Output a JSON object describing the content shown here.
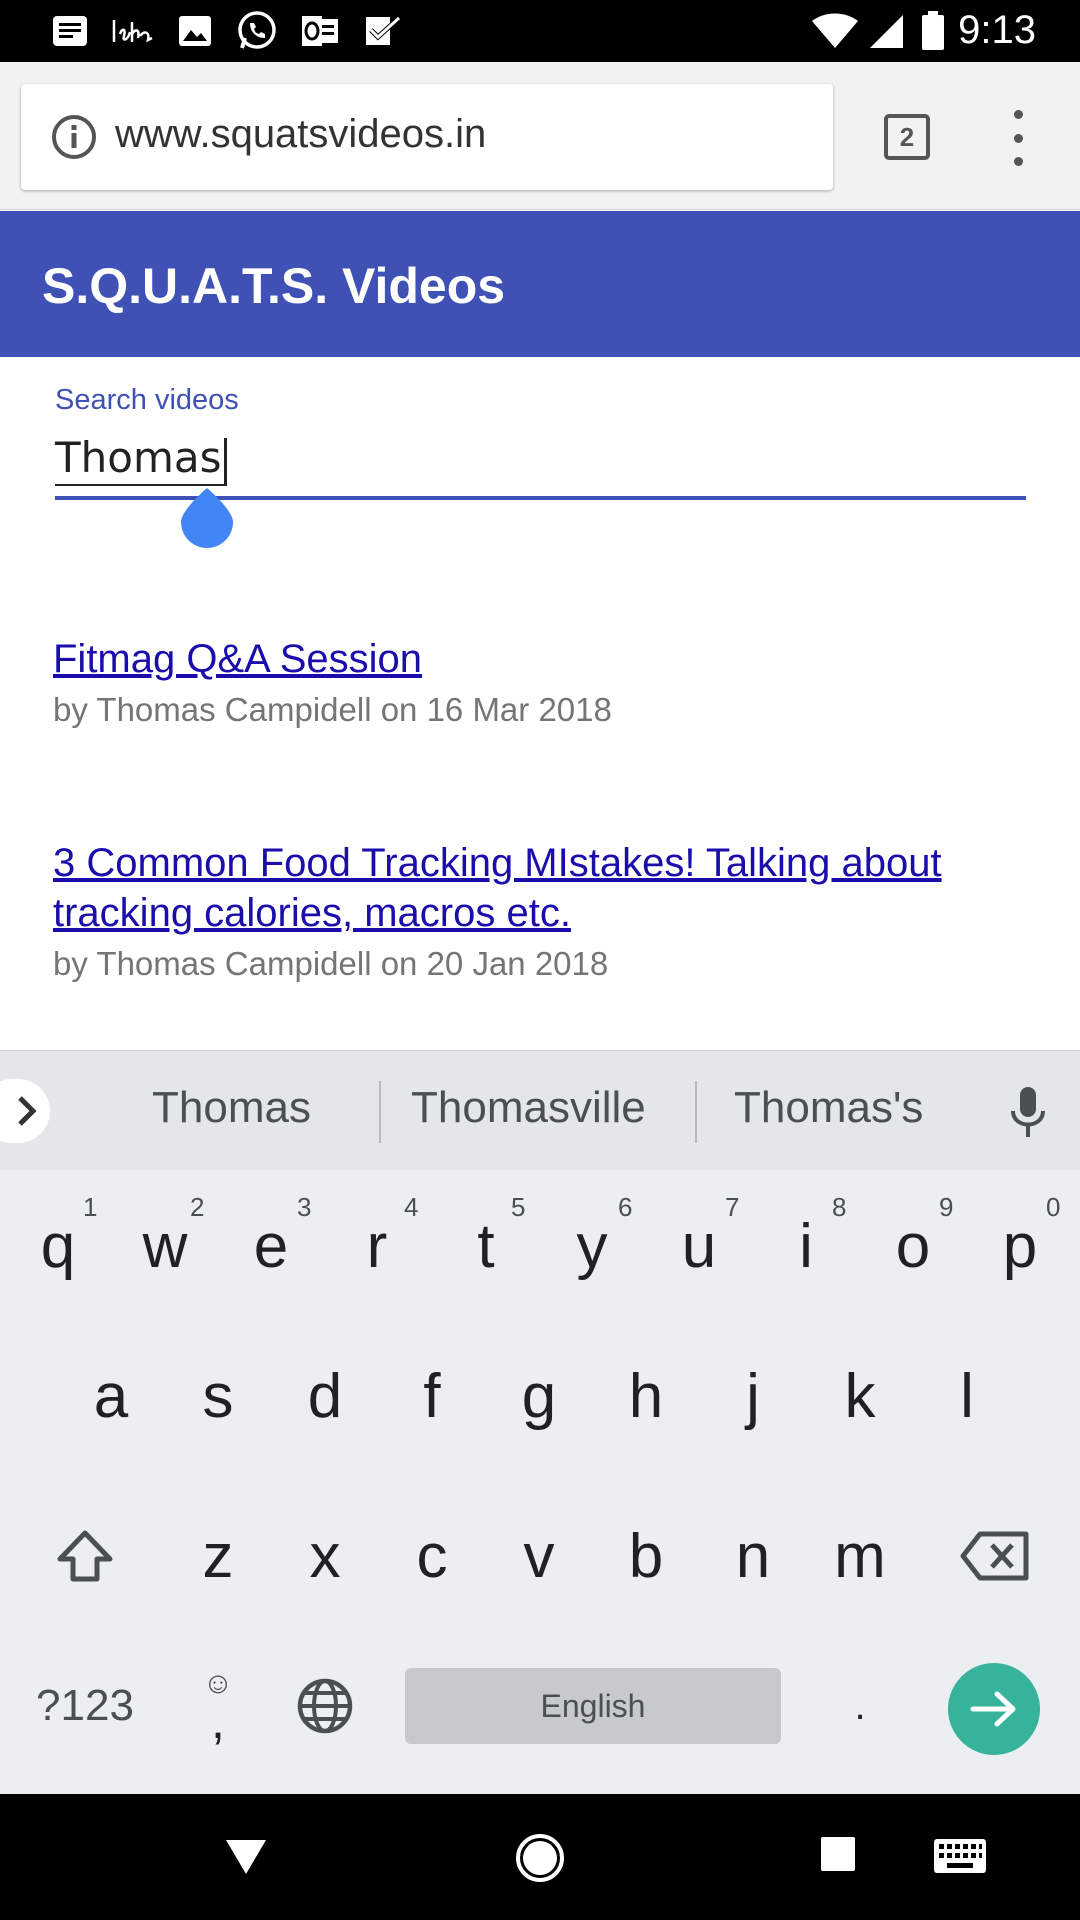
{
  "status_bar": {
    "time": "9:13",
    "left_icons": [
      "news-icon",
      "isha-app-icon",
      "gallery-icon",
      "whatsapp-icon",
      "outlook-icon",
      "tasks-check-icon"
    ],
    "right_icons": [
      "wifi-icon",
      "cellular-signal-icon",
      "battery-icon"
    ]
  },
  "browser": {
    "url": "www.squatsvideos.in",
    "tab_count": "2"
  },
  "app": {
    "title": "S.Q.U.A.T.S. Videos"
  },
  "search": {
    "label": "Search videos",
    "value": "Thomas"
  },
  "results": [
    {
      "title": "Fitmag Q&A Session",
      "meta": "by Thomas Campidell on 16 Mar 2018"
    },
    {
      "title_line1": "3 Common Food Tracking MIstakes! Talking about",
      "title_line2": "tracking calories, macros etc.",
      "meta": "by Thomas Campidell on 20 Jan 2018"
    }
  ],
  "keyboard": {
    "suggestions": [
      "Thomas",
      "Thomasville",
      "Thomas's"
    ],
    "row1": [
      "q",
      "w",
      "e",
      "r",
      "t",
      "y",
      "u",
      "i",
      "o",
      "p"
    ],
    "row1_hints": [
      "1",
      "2",
      "3",
      "4",
      "5",
      "6",
      "7",
      "8",
      "9",
      "0"
    ],
    "row2": [
      "a",
      "s",
      "d",
      "f",
      "g",
      "h",
      "j",
      "k",
      "l"
    ],
    "row3": [
      "z",
      "x",
      "c",
      "v",
      "b",
      "n",
      "m"
    ],
    "symbols_label": "?123",
    "comma_label": ",",
    "emoji_hint": "☺",
    "space_label": "English",
    "period_label": ".",
    "colors": {
      "enter": "#37b39b",
      "header": "#3f51b5"
    }
  },
  "nav": {
    "icons": [
      "back-icon",
      "home-icon",
      "recents-icon",
      "keyboard-switch-icon"
    ]
  }
}
